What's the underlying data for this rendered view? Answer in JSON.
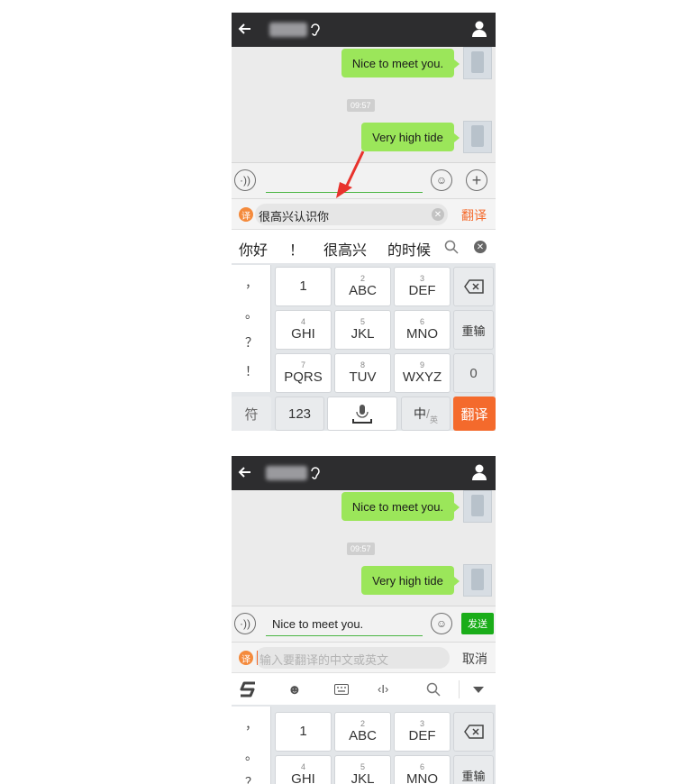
{
  "screens": [
    {
      "messages": [
        {
          "text": "Nice to meet you."
        },
        {
          "text": "Very high tide"
        }
      ],
      "timestamp": "09:57",
      "translate_input": "很高兴认识你",
      "translate_button": "翻译",
      "candidates": [
        "你好",
        "！",
        "很高兴",
        "的时候"
      ],
      "keyboard": {
        "symbols": [
          "，",
          "。",
          "？",
          "！"
        ],
        "keys": [
          {
            "num": "",
            "label": "1"
          },
          {
            "num": "2",
            "label": "ABC"
          },
          {
            "num": "3",
            "label": "DEF"
          },
          {
            "num": "4",
            "label": "GHI"
          },
          {
            "num": "5",
            "label": "JKL"
          },
          {
            "num": "6",
            "label": "MNO"
          },
          {
            "num": "7",
            "label": "PQRS"
          },
          {
            "num": "8",
            "label": "TUV"
          },
          {
            "num": "9",
            "label": "WXYZ"
          }
        ],
        "reinput": "重输",
        "zero": "0",
        "fu": "符",
        "num123": "123",
        "zh": "中",
        "en": "英",
        "translate_key": "翻译"
      }
    },
    {
      "messages": [
        {
          "text": "Nice to meet you."
        },
        {
          "text": "Very high tide"
        }
      ],
      "timestamp": "09:57",
      "input_value": "Nice to meet you.",
      "send_button": "发送",
      "translate_placeholder": "输入要翻译的中文或英文",
      "cancel_button": "取消",
      "keyboard": {
        "symbols": [
          "，",
          "。",
          "？"
        ],
        "keys": [
          {
            "num": "",
            "label": "1"
          },
          {
            "num": "2",
            "label": "ABC"
          },
          {
            "num": "3",
            "label": "DEF"
          },
          {
            "num": "4",
            "label": "GHI"
          },
          {
            "num": "5",
            "label": "JKL"
          },
          {
            "num": "6",
            "label": "MNO"
          }
        ],
        "reinput": "重输"
      }
    }
  ],
  "colors": {
    "titlebar": "#2d2d2f",
    "bubble": "#9be65a",
    "accent_orange": "#f46a2c",
    "send_green": "#1aad19",
    "arrow_red": "#e8322c"
  }
}
